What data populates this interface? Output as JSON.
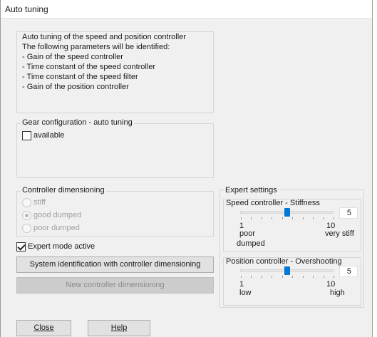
{
  "window": {
    "title": "Auto tuning"
  },
  "autotune": {
    "lines": [
      "Auto tuning of the speed and position controller",
      "The following parameters will be identified:",
      " - Gain of the speed controller",
      " - Time constant of the speed controller",
      " - Time constant of the speed filter",
      " - Gain of the position controller"
    ]
  },
  "gear": {
    "caption": "Gear configuration - auto tuning",
    "checkbox_label": "available",
    "checked": false
  },
  "dimensioning": {
    "caption": "Controller dimensioning",
    "options": [
      "stiff",
      "good dumped",
      "poor dumped"
    ],
    "selected": "good dumped"
  },
  "expert_mode": {
    "label": "Expert mode active",
    "checked": true
  },
  "buttons": {
    "system_identification": "System identification with controller dimensioning",
    "new_dimensioning": "New controller dimensioning",
    "close": "Close",
    "help": "Help"
  },
  "expert": {
    "caption": "Expert settings",
    "speed": {
      "title": "Speed controller - Stiffness",
      "value": "5",
      "min": "1",
      "max": "10",
      "min_label": "poor",
      "min_label2": "dumped",
      "max_label": "very stiff"
    },
    "position": {
      "title": "Position controller - Overshooting",
      "value": "5",
      "min": "1",
      "max": "10",
      "min_label": "low",
      "max_label": "high"
    }
  },
  "colors": {
    "accent": "#0078d7",
    "background": "#f0f0f0"
  }
}
